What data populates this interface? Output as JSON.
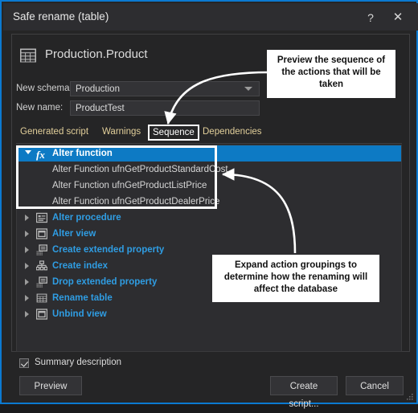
{
  "window": {
    "title": "Safe rename (table)",
    "help_label": "?",
    "close_label": "✕",
    "accent_color": "#0b7ad1"
  },
  "header": {
    "object_icon": "table-icon",
    "object_name": "Production.Product"
  },
  "form": {
    "schema_label": "New schema:",
    "schema_value": "Production",
    "name_label": "New name:",
    "name_value": "ProductTest"
  },
  "tabs": {
    "items": [
      {
        "label": "Generated script",
        "selected": false
      },
      {
        "label": "Warnings",
        "selected": false
      },
      {
        "label": "Sequence",
        "selected": true
      },
      {
        "label": "Dependencies",
        "selected": false
      }
    ]
  },
  "tree": {
    "groups": [
      {
        "label": "Alter function",
        "icon": "function-fx-icon",
        "expanded": true,
        "selected": true,
        "children": [
          "Alter Function ufnGetProductStandardCost",
          "Alter Function ufnGetProductListPrice",
          "Alter Function ufnGetProductDealerPrice"
        ]
      },
      {
        "label": "Alter procedure",
        "icon": "procedure-icon",
        "expanded": false,
        "selected": false,
        "children": []
      },
      {
        "label": "Alter view",
        "icon": "view-icon",
        "expanded": false,
        "selected": false,
        "children": []
      },
      {
        "label": "Create extended property",
        "icon": "extended-property-icon",
        "expanded": false,
        "selected": false,
        "children": []
      },
      {
        "label": "Create index",
        "icon": "index-icon",
        "expanded": false,
        "selected": false,
        "children": []
      },
      {
        "label": "Drop extended property",
        "icon": "extended-property-icon",
        "expanded": false,
        "selected": false,
        "children": []
      },
      {
        "label": "Rename table",
        "icon": "table-icon",
        "expanded": false,
        "selected": false,
        "children": []
      },
      {
        "label": "Unbind view",
        "icon": "view-icon",
        "expanded": false,
        "selected": false,
        "children": []
      }
    ],
    "selection_color": "#0d7ac4",
    "item_color": "#2f9de3"
  },
  "footer": {
    "summary_checkbox_label": "Summary description",
    "summary_checked": true,
    "preview_label": "Preview",
    "create_script_label": "Create script...",
    "cancel_label": "Cancel"
  },
  "annotations": [
    {
      "id": "callout-sequence",
      "text": "Preview the sequence of the actions that will be taken"
    },
    {
      "id": "callout-expand",
      "text": "Expand action groupings to determine how the renaming will affect the database"
    }
  ]
}
